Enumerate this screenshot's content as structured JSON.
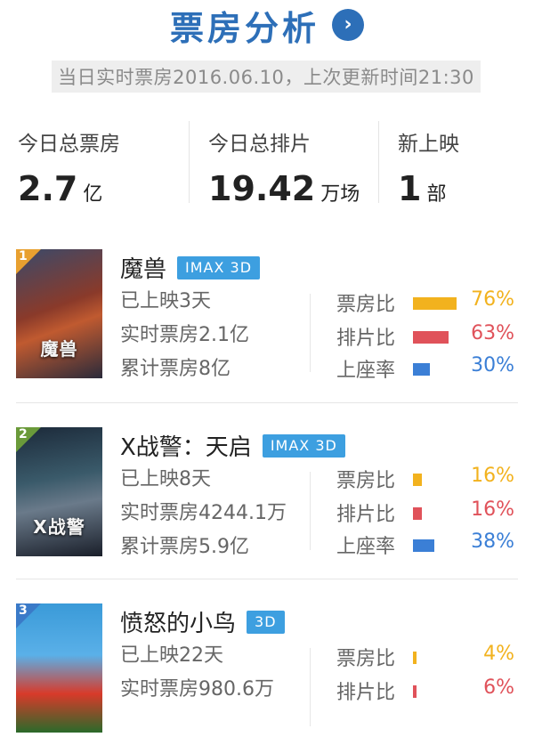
{
  "header": {
    "title": "票房分析",
    "arrow": "›"
  },
  "updated": "当日实时票房2016.06.10，上次更新时间21:30",
  "stats": [
    {
      "label": "今日总票房",
      "value": "2.7",
      "unit": "亿"
    },
    {
      "label": "今日总排片",
      "value": "19.42",
      "unit": "万场"
    },
    {
      "label": "新上映",
      "value": "1",
      "unit": "部"
    }
  ],
  "metric_colors": {
    "box": "#f2b21e",
    "schedule": "#e0525a",
    "seat": "#3b7fd6"
  },
  "movies": [
    {
      "rank": "1",
      "rank_color": "#e8a030",
      "name": "魔兽",
      "tag": "IMAX 3D",
      "poster_text": "魔兽",
      "days": "已上映3天",
      "live": "实时票房2.1亿",
      "total": "累计票房8亿",
      "metrics": [
        {
          "label": "票房比",
          "percent": 76,
          "text": "76%"
        },
        {
          "label": "排片比",
          "percent": 63,
          "text": "63%"
        },
        {
          "label": "上座率",
          "percent": 30,
          "text": "30%"
        }
      ]
    },
    {
      "rank": "2",
      "rank_color": "#6a9a3a",
      "name": "X战警：天启",
      "tag": "IMAX 3D",
      "poster_text": "X战警",
      "days": "已上映8天",
      "live": "实时票房4244.1万",
      "total": "累计票房5.9亿",
      "metrics": [
        {
          "label": "票房比",
          "percent": 16,
          "text": "16%"
        },
        {
          "label": "排片比",
          "percent": 16,
          "text": "16%"
        },
        {
          "label": "上座率",
          "percent": 38,
          "text": "38%"
        }
      ]
    },
    {
      "rank": "3",
      "rank_color": "#3a7ac8",
      "name": "愤怒的小鸟",
      "tag": "3D",
      "poster_text": "",
      "days": "已上映22天",
      "live": "实时票房980.6万",
      "total": "",
      "metrics": [
        {
          "label": "票房比",
          "percent": 4,
          "text": "4%"
        },
        {
          "label": "排片比",
          "percent": 6,
          "text": "6%"
        }
      ]
    }
  ]
}
